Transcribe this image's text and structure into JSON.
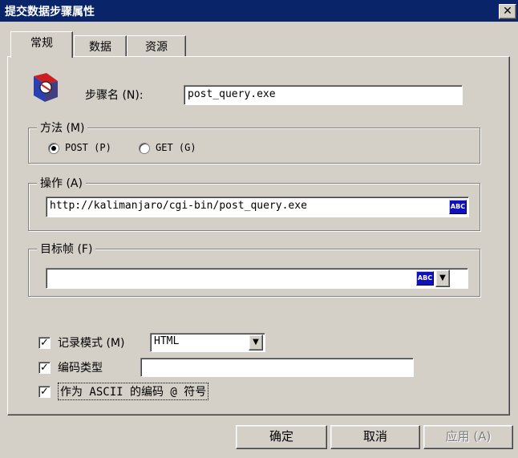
{
  "window": {
    "title": "提交数据步骤属性",
    "close_glyph": "✕"
  },
  "tabs": [
    {
      "label": "常规",
      "active": true
    },
    {
      "label": "数据",
      "active": false
    },
    {
      "label": "资源",
      "active": false
    }
  ],
  "step_name": {
    "label": "步骤名 (N):",
    "value": "post_query.exe"
  },
  "method": {
    "legend": "方法 (M)",
    "options": [
      {
        "label": "POST (P)",
        "selected": true
      },
      {
        "label": "GET (G)",
        "selected": false
      }
    ]
  },
  "action": {
    "legend": "操作 (A)",
    "value": "http://kalimanjaro/cgi-bin/post_query.exe",
    "abc_label": "ABC"
  },
  "target_frame": {
    "legend": "目标帧 (F)",
    "value": "",
    "abc_label": "ABC",
    "dropdown_glyph": "▼"
  },
  "options": {
    "record_mode": {
      "label": "记录模式 (M)",
      "checked": true,
      "value": "HTML",
      "dropdown_glyph": "▼"
    },
    "encoding_type": {
      "label": "编码类型",
      "checked": true,
      "value": ""
    },
    "ascii_encoding": {
      "label": "作为 ASCII 的编码 @ 符号",
      "checked": true
    },
    "check_glyph": "✓"
  },
  "buttons": {
    "ok": "确定",
    "cancel": "取消",
    "apply": "应用 (A)"
  }
}
